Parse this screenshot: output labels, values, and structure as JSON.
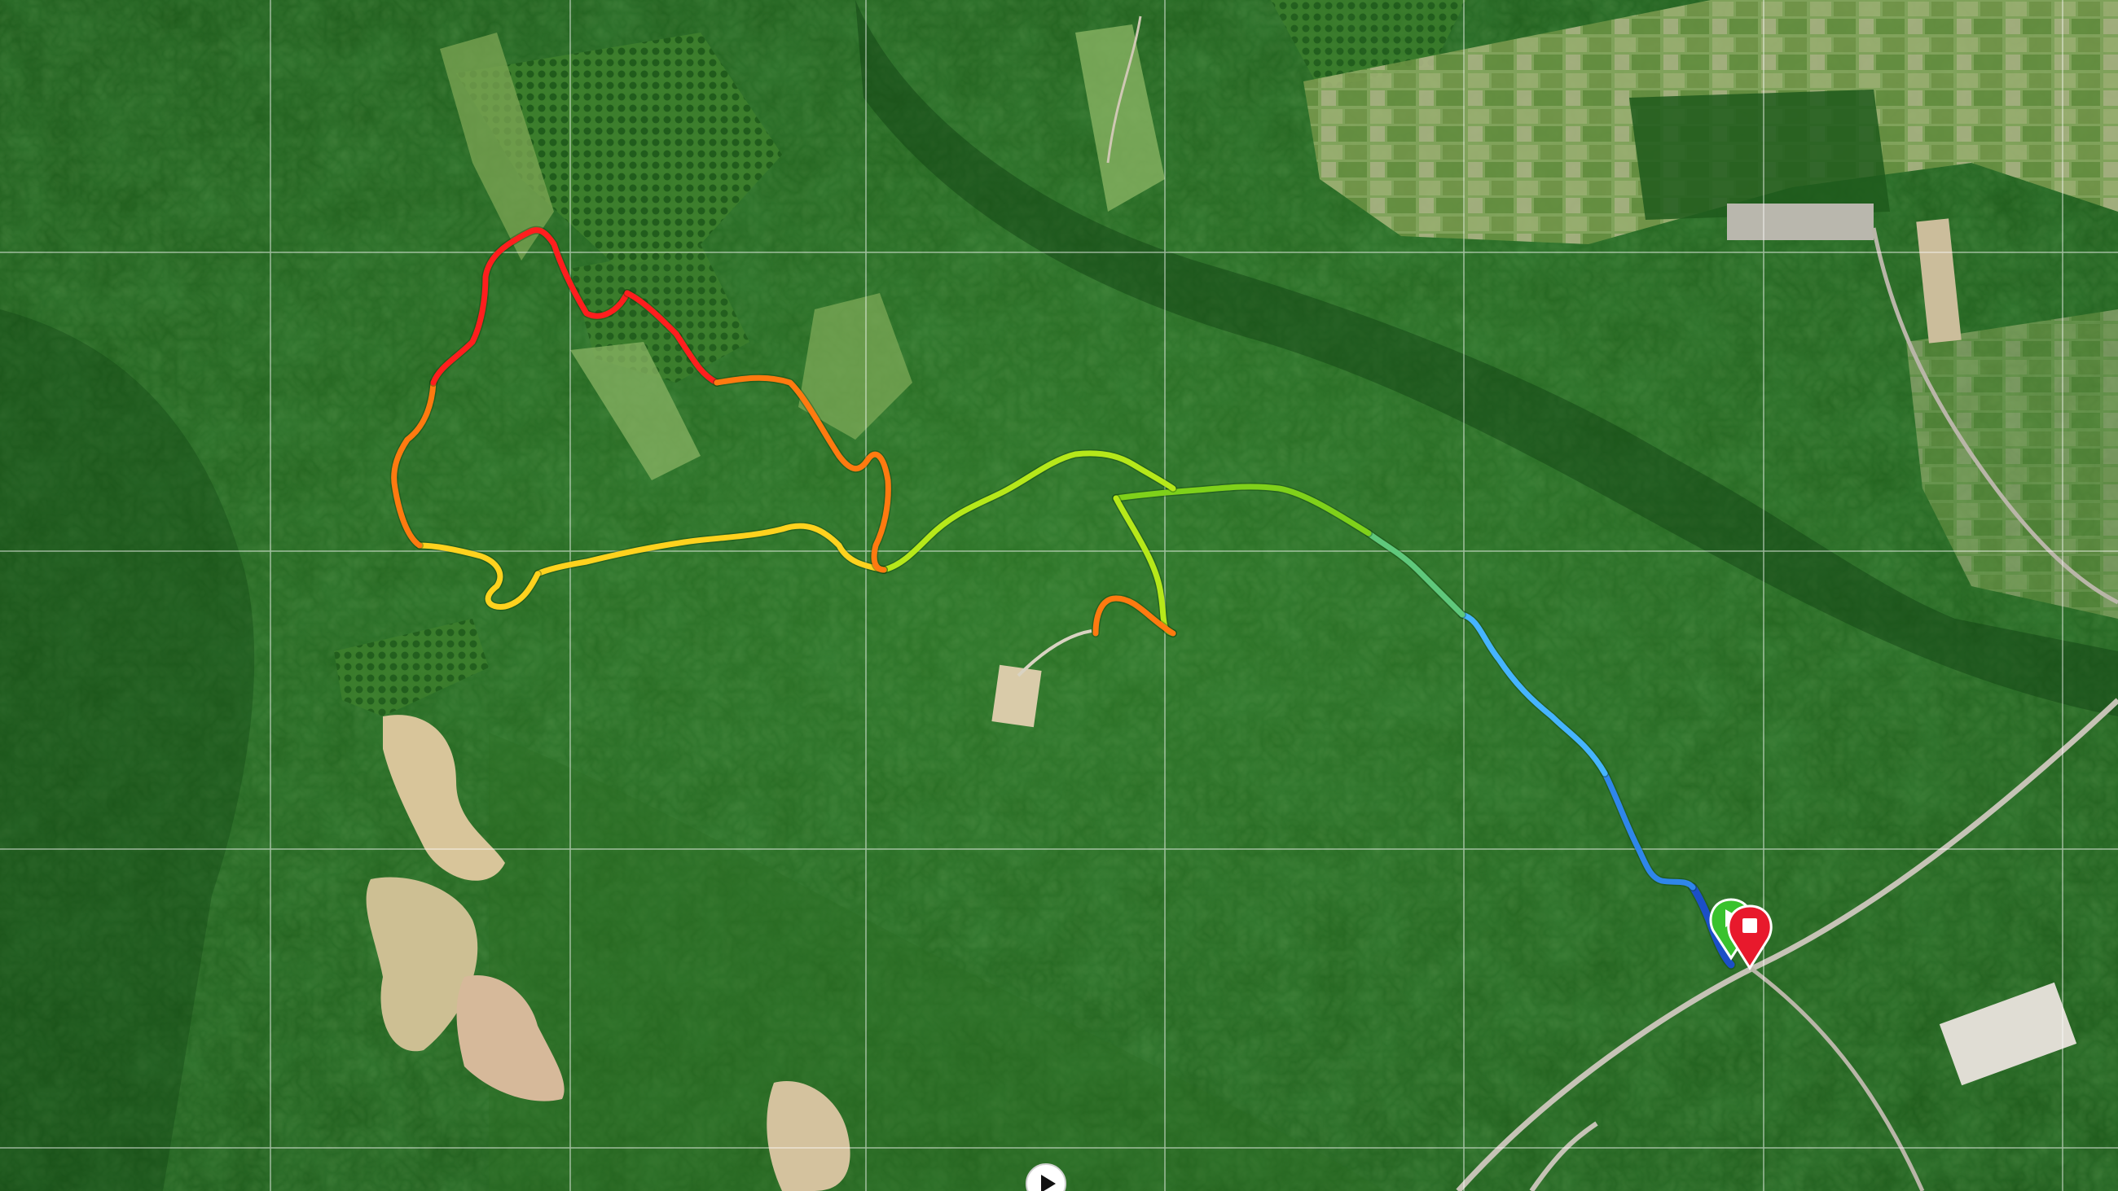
{
  "map": {
    "view": "satellite",
    "background_color": "#22611f",
    "grid_color": "#ffffff"
  },
  "track": {
    "color_scale": [
      "#ff1e1e",
      "#ff7a10",
      "#ffd21e",
      "#b6e81a",
      "#7fd11a",
      "#5fc87c",
      "#46b4ff",
      "#2f86ea",
      "#1b4fc7"
    ],
    "start_marker": {
      "icon": "start-flag-icon",
      "color": "#39c22e"
    },
    "end_marker": {
      "icon": "stop-pin-icon",
      "color": "#e8192c"
    }
  },
  "controls": {
    "play_icon": "play-icon"
  }
}
